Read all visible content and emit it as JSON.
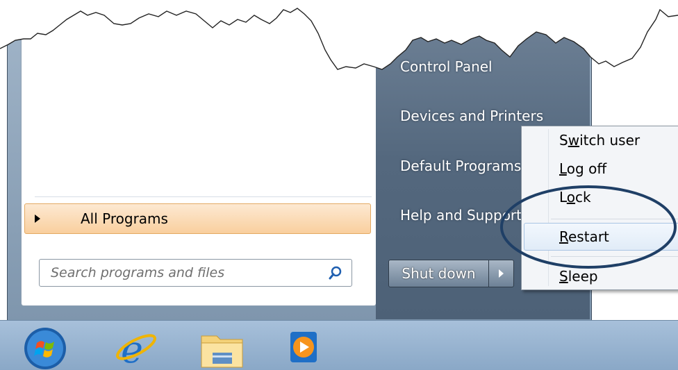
{
  "right_pane": {
    "items": [
      {
        "label": "Control Panel"
      },
      {
        "label": "Devices and Printers"
      },
      {
        "label": "Default Programs"
      },
      {
        "label": "Help and Support"
      }
    ]
  },
  "left_pane": {
    "all_programs_label": "All Programs",
    "search_placeholder": "Search programs and files"
  },
  "shutdown": {
    "label": "Shut down"
  },
  "context_menu": {
    "items": [
      {
        "label": "Switch user",
        "accel_index": 1
      },
      {
        "label": "Log off",
        "accel_index": 0
      },
      {
        "label": "Lock",
        "accel_index": 1
      },
      {
        "label": "Restart",
        "accel_index": 0
      },
      {
        "label": "Sleep",
        "accel_index": 0
      }
    ],
    "highlighted": "Restart"
  },
  "taskbar": {
    "icons": [
      "start-orb-icon",
      "internet-explorer-icon",
      "windows-explorer-icon",
      "media-player-icon"
    ]
  },
  "colors": {
    "highlight_ellipse": "#1f3f66",
    "all_programs_bg": "#f9cf9e"
  }
}
